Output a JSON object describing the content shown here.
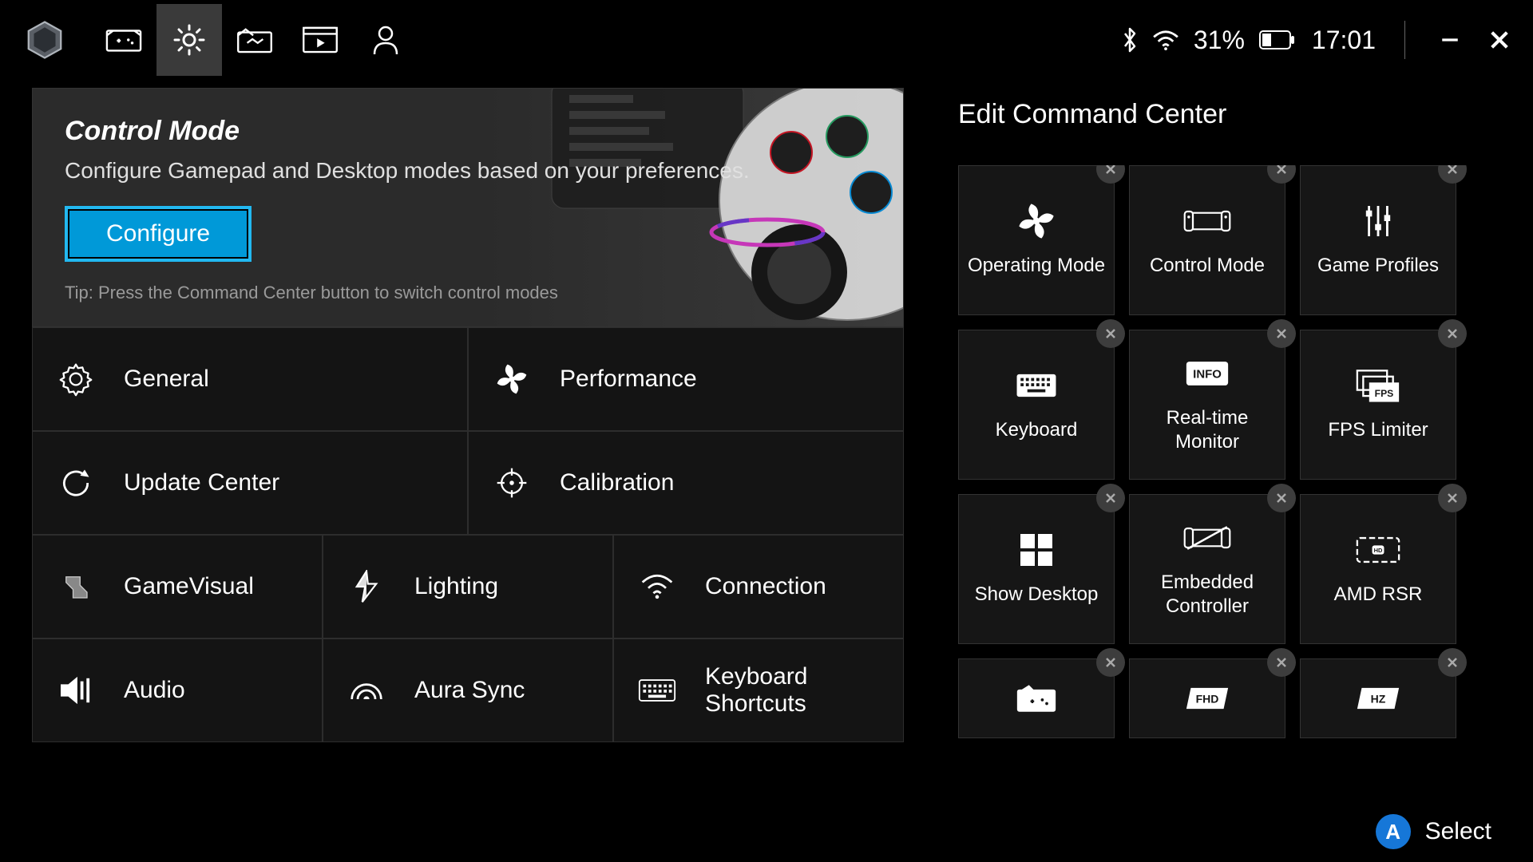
{
  "topbar": {
    "battery_pct": "31%",
    "time": "17:01"
  },
  "hero": {
    "title": "Control Mode",
    "desc": "Configure Gamepad and Desktop modes based on your preferences.",
    "button": "Configure",
    "tip": "Tip: Press the Command Center button to switch control modes"
  },
  "categories": {
    "row1": [
      {
        "id": "general",
        "label": "General"
      },
      {
        "id": "performance",
        "label": "Performance"
      }
    ],
    "row2": [
      {
        "id": "update-center",
        "label": "Update Center"
      },
      {
        "id": "calibration",
        "label": "Calibration"
      }
    ],
    "row3": [
      {
        "id": "gamevisual",
        "label": "GameVisual"
      },
      {
        "id": "lighting",
        "label": "Lighting"
      },
      {
        "id": "connection",
        "label": "Connection"
      }
    ],
    "row4": [
      {
        "id": "audio",
        "label": "Audio"
      },
      {
        "id": "aura-sync",
        "label": "Aura Sync"
      },
      {
        "id": "keyboard-shortcuts",
        "label": "Keyboard Shortcuts"
      }
    ]
  },
  "right": {
    "title": "Edit Command Center",
    "tiles": [
      {
        "id": "operating-mode",
        "label": "Operating Mode"
      },
      {
        "id": "control-mode",
        "label": "Control Mode"
      },
      {
        "id": "game-profiles",
        "label": "Game Profiles"
      },
      {
        "id": "keyboard",
        "label": "Keyboard"
      },
      {
        "id": "real-time-monitor",
        "label": "Real-time Monitor"
      },
      {
        "id": "fps-limiter",
        "label": "FPS Limiter"
      },
      {
        "id": "show-desktop",
        "label": "Show Desktop"
      },
      {
        "id": "embedded-controller",
        "label": "Embedded Controller"
      },
      {
        "id": "amd-rsr",
        "label": "AMD RSR"
      },
      {
        "id": "library",
        "label": ""
      },
      {
        "id": "fhd",
        "label": ""
      },
      {
        "id": "refresh",
        "label": ""
      }
    ]
  },
  "footer": {
    "select": "Select",
    "glyph": "A"
  }
}
